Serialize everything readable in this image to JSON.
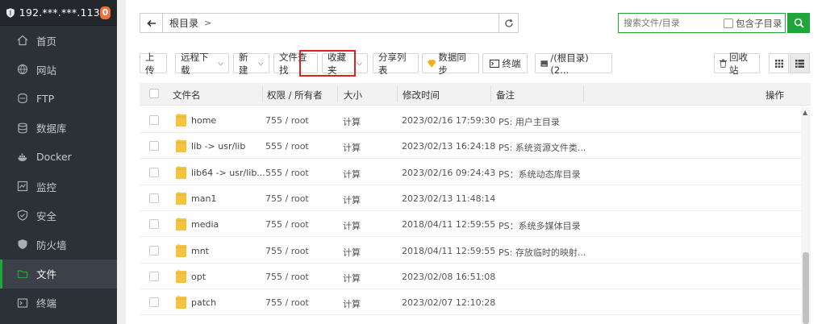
{
  "sidebar": {
    "server_ip": "192.***.***.113",
    "badge_count": "0",
    "items": [
      {
        "label": "首页",
        "icon": "home-icon"
      },
      {
        "label": "网站",
        "icon": "globe-icon"
      },
      {
        "label": "FTP",
        "icon": "ftp-icon"
      },
      {
        "label": "数据库",
        "icon": "database-icon"
      },
      {
        "label": "Docker",
        "icon": "docker-icon"
      },
      {
        "label": "监控",
        "icon": "monitor-icon"
      },
      {
        "label": "安全",
        "icon": "security-shield-icon"
      },
      {
        "label": "防火墙",
        "icon": "firewall-icon"
      },
      {
        "label": "文件",
        "icon": "folder-icon",
        "active": true
      },
      {
        "label": "终端",
        "icon": "terminal-icon"
      }
    ]
  },
  "path": {
    "root_label": "根目录",
    "separator": ">"
  },
  "search": {
    "placeholder": "搜索文件/目录",
    "include_subdir_label": "包含子目录"
  },
  "toolbar": {
    "upload": "上传",
    "remote_download": "远程下载",
    "new": "新建",
    "file_search": "文件查找",
    "favorites": "收藏夹",
    "share_list": "分享列表",
    "data_sync": "数据同步",
    "terminal": "终端",
    "disk": "/(根目录) (2...",
    "recycle_bin": "回收站"
  },
  "table": {
    "headers": {
      "name": "文件名",
      "perm_owner": "权限 / 所有者",
      "size": "大小",
      "mtime": "修改时间",
      "note": "备注",
      "ops": "操作"
    },
    "rows": [
      {
        "name": "home",
        "perm": "755 / root",
        "size": "计算",
        "mtime": "2023/02/16 17:59:30",
        "note": "PS: 用户主目录"
      },
      {
        "name": "lib -> usr/lib",
        "perm": "555 / root",
        "size": "计算",
        "mtime": "2023/02/13 16:24:18",
        "note": "PS: 系统资源文件类..."
      },
      {
        "name": "lib64 -> usr/lib...",
        "perm": "555 / root",
        "size": "计算",
        "mtime": "2023/02/16 09:24:43",
        "note": "PS：系统动态库目录"
      },
      {
        "name": "man1",
        "perm": "755 / root",
        "size": "计算",
        "mtime": "2023/02/13 11:48:14",
        "note": ""
      },
      {
        "name": "media",
        "perm": "755 / root",
        "size": "计算",
        "mtime": "2018/04/11 12:59:55",
        "note": "PS：系统多媒体目录"
      },
      {
        "name": "mnt",
        "perm": "755 / root",
        "size": "计算",
        "mtime": "2018/04/11 12:59:55",
        "note": "PS: 存放临时的映射..."
      },
      {
        "name": "opt",
        "perm": "755 / root",
        "size": "计算",
        "mtime": "2023/02/08 16:51:08",
        "note": ""
      },
      {
        "name": "patch",
        "perm": "755 / root",
        "size": "计算",
        "mtime": "2023/02/07 12:10:28",
        "note": ""
      }
    ]
  },
  "colors": {
    "accent_green": "#20a53a",
    "sidebar_bg": "#2c3138",
    "badge_orange": "#f0713c",
    "highlight_red": "#d9251d",
    "folder_yellow": "#f5c342"
  }
}
